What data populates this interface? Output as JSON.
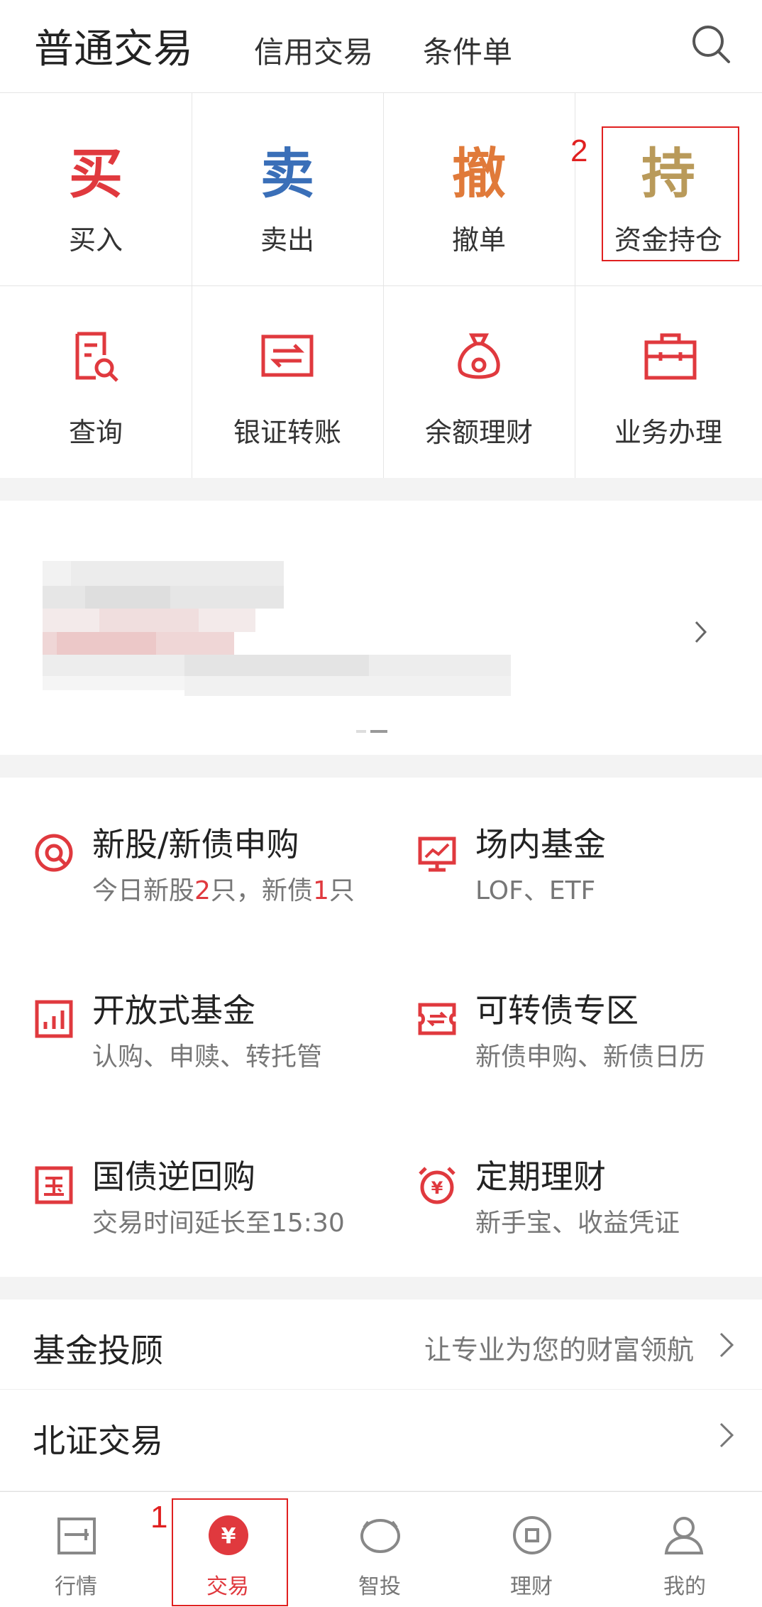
{
  "header": {
    "title": "普通交易",
    "tab_credit": "信用交易",
    "tab_condition": "条件单"
  },
  "grid": {
    "buy": {
      "glyph": "买",
      "label": "买入"
    },
    "sell": {
      "glyph": "卖",
      "label": "卖出"
    },
    "cancel": {
      "glyph": "撤",
      "label": "撤单"
    },
    "hold": {
      "glyph": "持",
      "label": "资金持仓"
    },
    "query": {
      "label": "查询"
    },
    "transfer": {
      "label": "银证转账"
    },
    "balance": {
      "label": "余额理财"
    },
    "business": {
      "label": "业务办理"
    }
  },
  "services": {
    "ipo": {
      "title": "新股/新债申购",
      "sub_pre": "今日新股",
      "sub_n1": "2",
      "sub_mid": "只，新债",
      "sub_n2": "1",
      "sub_post": "只"
    },
    "etf": {
      "title": "场内基金",
      "sub": "LOF、ETF"
    },
    "openfund": {
      "title": "开放式基金",
      "sub": "认购、申赎、转托管"
    },
    "convert": {
      "title": "可转债专区",
      "sub": "新债申购、新债日历"
    },
    "repo": {
      "title": "国债逆回购",
      "sub": "交易时间延长至15:30"
    },
    "fixed": {
      "title": "定期理财",
      "sub": "新手宝、收益凭证"
    }
  },
  "rows": {
    "advisor": {
      "title": "基金投顾",
      "sub": "让专业为您的财富领航"
    },
    "bse": {
      "title": "北证交易"
    }
  },
  "tabs": {
    "market": "行情",
    "trade": "交易",
    "invest": "智投",
    "finance": "理财",
    "mine": "我的"
  },
  "annotations": {
    "n1": "1",
    "n2": "2"
  },
  "colors": {
    "red": "#e0393e",
    "blue": "#3a6fb8",
    "orange": "#e07a3a",
    "gold": "#b99a5a",
    "highlight": "#e02020"
  }
}
